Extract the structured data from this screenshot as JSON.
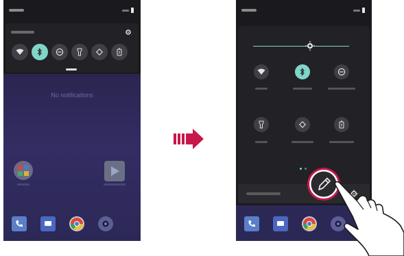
{
  "left_screen": {
    "quick_settings_compact": {
      "tiles": [
        "wifi-icon",
        "bluetooth-icon",
        "do-not-disturb-icon",
        "flashlight-icon",
        "auto-rotate-icon",
        "battery-saver-icon"
      ],
      "active_tile": "bluetooth-icon"
    },
    "notifications": {
      "empty_text": "No notifications"
    },
    "dock_apps": [
      "phone-icon",
      "messages-icon",
      "chrome-icon",
      "camera-icon"
    ]
  },
  "right_screen": {
    "quick_settings_expanded": {
      "tiles": [
        "wifi-icon",
        "bluetooth-icon",
        "do-not-disturb-icon",
        "flashlight-icon",
        "auto-rotate-icon",
        "battery-saver-icon"
      ],
      "active_tile": "bluetooth-icon",
      "page_indicator_count": 2
    },
    "edit_button": "edit-pencil-icon",
    "settings_button": "gear-icon",
    "dock_apps": [
      "phone-icon",
      "messages-icon",
      "chrome-icon",
      "camera-icon"
    ]
  },
  "colors": {
    "accent": "#7fd6c8",
    "highlight_ring": "#c8174a",
    "arrow": "#c8174a",
    "panel": "#222226"
  }
}
